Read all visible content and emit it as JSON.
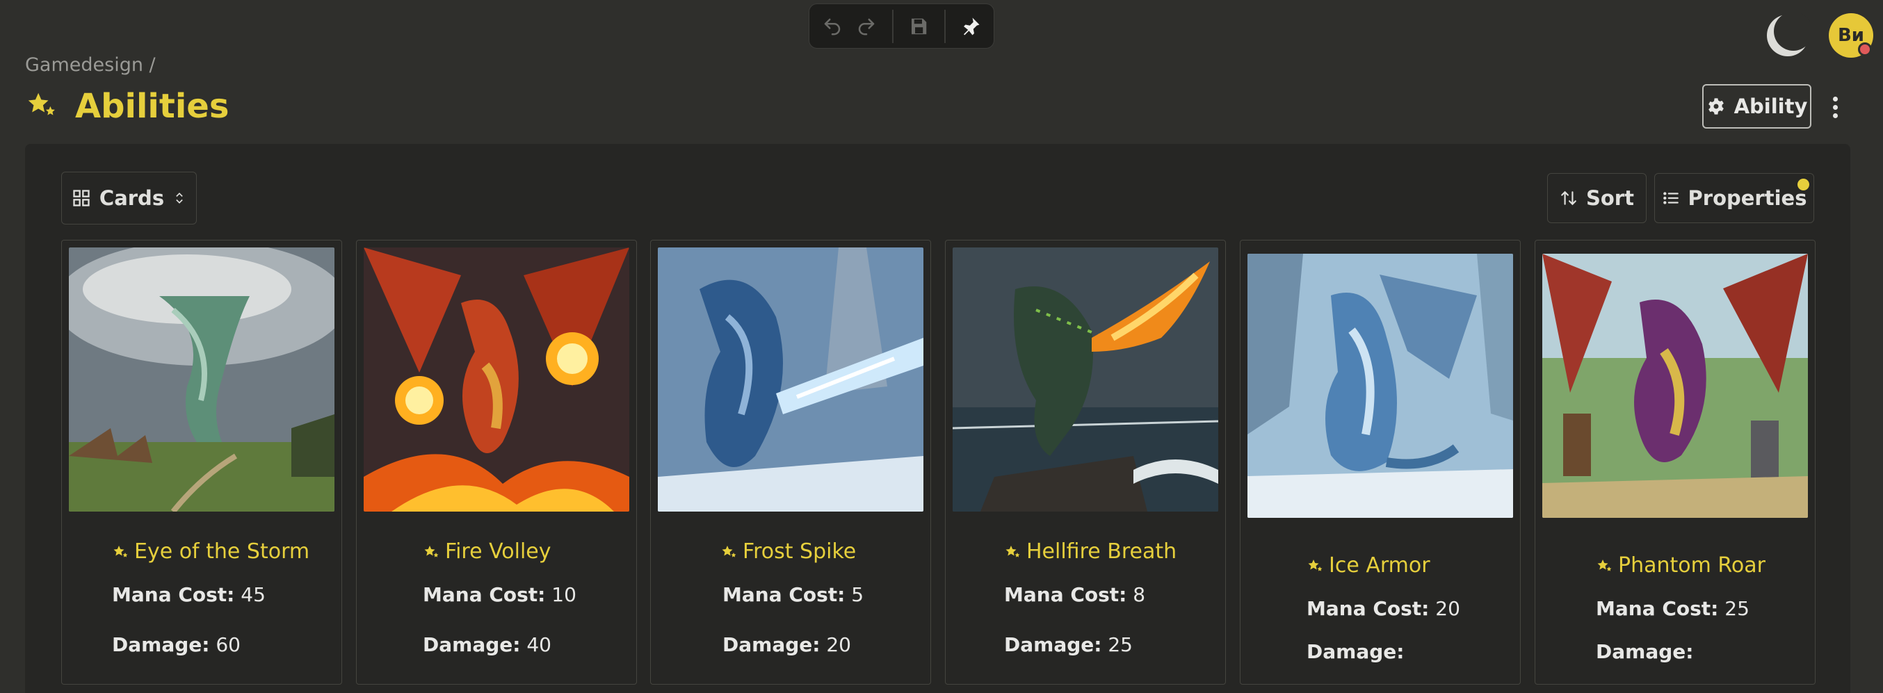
{
  "toolbar": {
    "undo_icon": "undo-icon",
    "redo_icon": "redo-icon",
    "save_icon": "save-icon",
    "pin_icon": "pin-icon"
  },
  "user": {
    "initials": "Ви",
    "theme_icon": "moon-icon"
  },
  "breadcrumb": {
    "path": "Gamedesign /"
  },
  "page": {
    "title": "Abilities",
    "title_icon": "sparkle-icon",
    "accent": "#e6cf3c"
  },
  "header": {
    "ability_button": "Ability"
  },
  "view": {
    "mode_label": "Cards",
    "sort_label": "Sort",
    "properties_label": "Properties"
  },
  "cards": [
    {
      "name": "Eye of the Storm",
      "mana_label": "Mana Cost:",
      "mana": "45",
      "damage_label": "Damage:",
      "damage": "60",
      "art": "tornado"
    },
    {
      "name": "Fire Volley",
      "mana_label": "Mana Cost:",
      "mana": "10",
      "damage_label": "Damage:",
      "damage": "40",
      "art": "fire-dragon"
    },
    {
      "name": "Frost Spike",
      "mana_label": "Mana Cost:",
      "mana": "5",
      "damage_label": "Damage:",
      "damage": "20",
      "art": "ice-dragon"
    },
    {
      "name": "Hellfire Breath",
      "mana_label": "Mana Cost:",
      "mana": "8",
      "damage_label": "Damage:",
      "damage": "25",
      "art": "dark-dragon"
    },
    {
      "name": "Ice Armor",
      "mana_label": "Mana Cost:",
      "mana": "20",
      "damage_label": "Damage:",
      "damage": "",
      "art": "frost-dragon"
    },
    {
      "name": "Phantom Roar",
      "mana_label": "Mana Cost:",
      "mana": "25",
      "damage_label": "Damage:",
      "damage": "",
      "art": "purple-dragon"
    }
  ]
}
